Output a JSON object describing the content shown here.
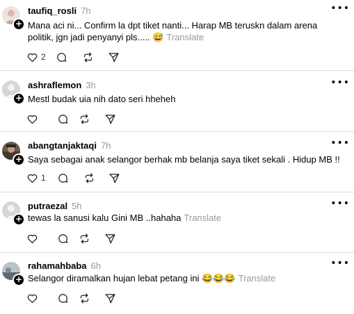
{
  "posts": [
    {
      "username": "taufiq_rosli",
      "time": "7h",
      "text": "Mana aci ni... Confirm la dpt tiket nanti... Harap MB teruskn dalam arena politik, jgn jadi penyanyi pls..... 😅",
      "translate": "Translate",
      "like_count": "2",
      "avatar_color": "#e7d6d2"
    },
    {
      "username": "ashraflemon",
      "time": "3h",
      "text": "Mestl budak uia nih dato seri hheheh",
      "translate": "",
      "like_count": "",
      "avatar_color": "#c7c7c7"
    },
    {
      "username": "abangtanjaktaqi",
      "time": "7h",
      "text": "Saya sebagai anak selangor berhak mb belanja saya tiket sekali . Hidup MB !!",
      "translate": "",
      "like_count": "1",
      "avatar_color": "#5a4a3a"
    },
    {
      "username": "putraezal",
      "time": "5h",
      "text": "tewas la sanusi kalu Gini MB ..hahaha",
      "translate": "Translate",
      "like_count": "",
      "avatar_color": "#c7c7c7"
    },
    {
      "username": "rahamahbaba",
      "time": "6h",
      "text": "Selangor diramalkan hujan lebat petang ini 😂😂😂",
      "translate": "Translate",
      "like_count": "",
      "avatar_color": "#a9b4bd"
    }
  ],
  "icons": {
    "like": "heart-icon",
    "comment": "comment-icon",
    "repost": "repost-icon",
    "share": "send-icon",
    "more": "more-icon",
    "follow": "plus-icon"
  },
  "more_label": "•••",
  "follow_label": "+"
}
